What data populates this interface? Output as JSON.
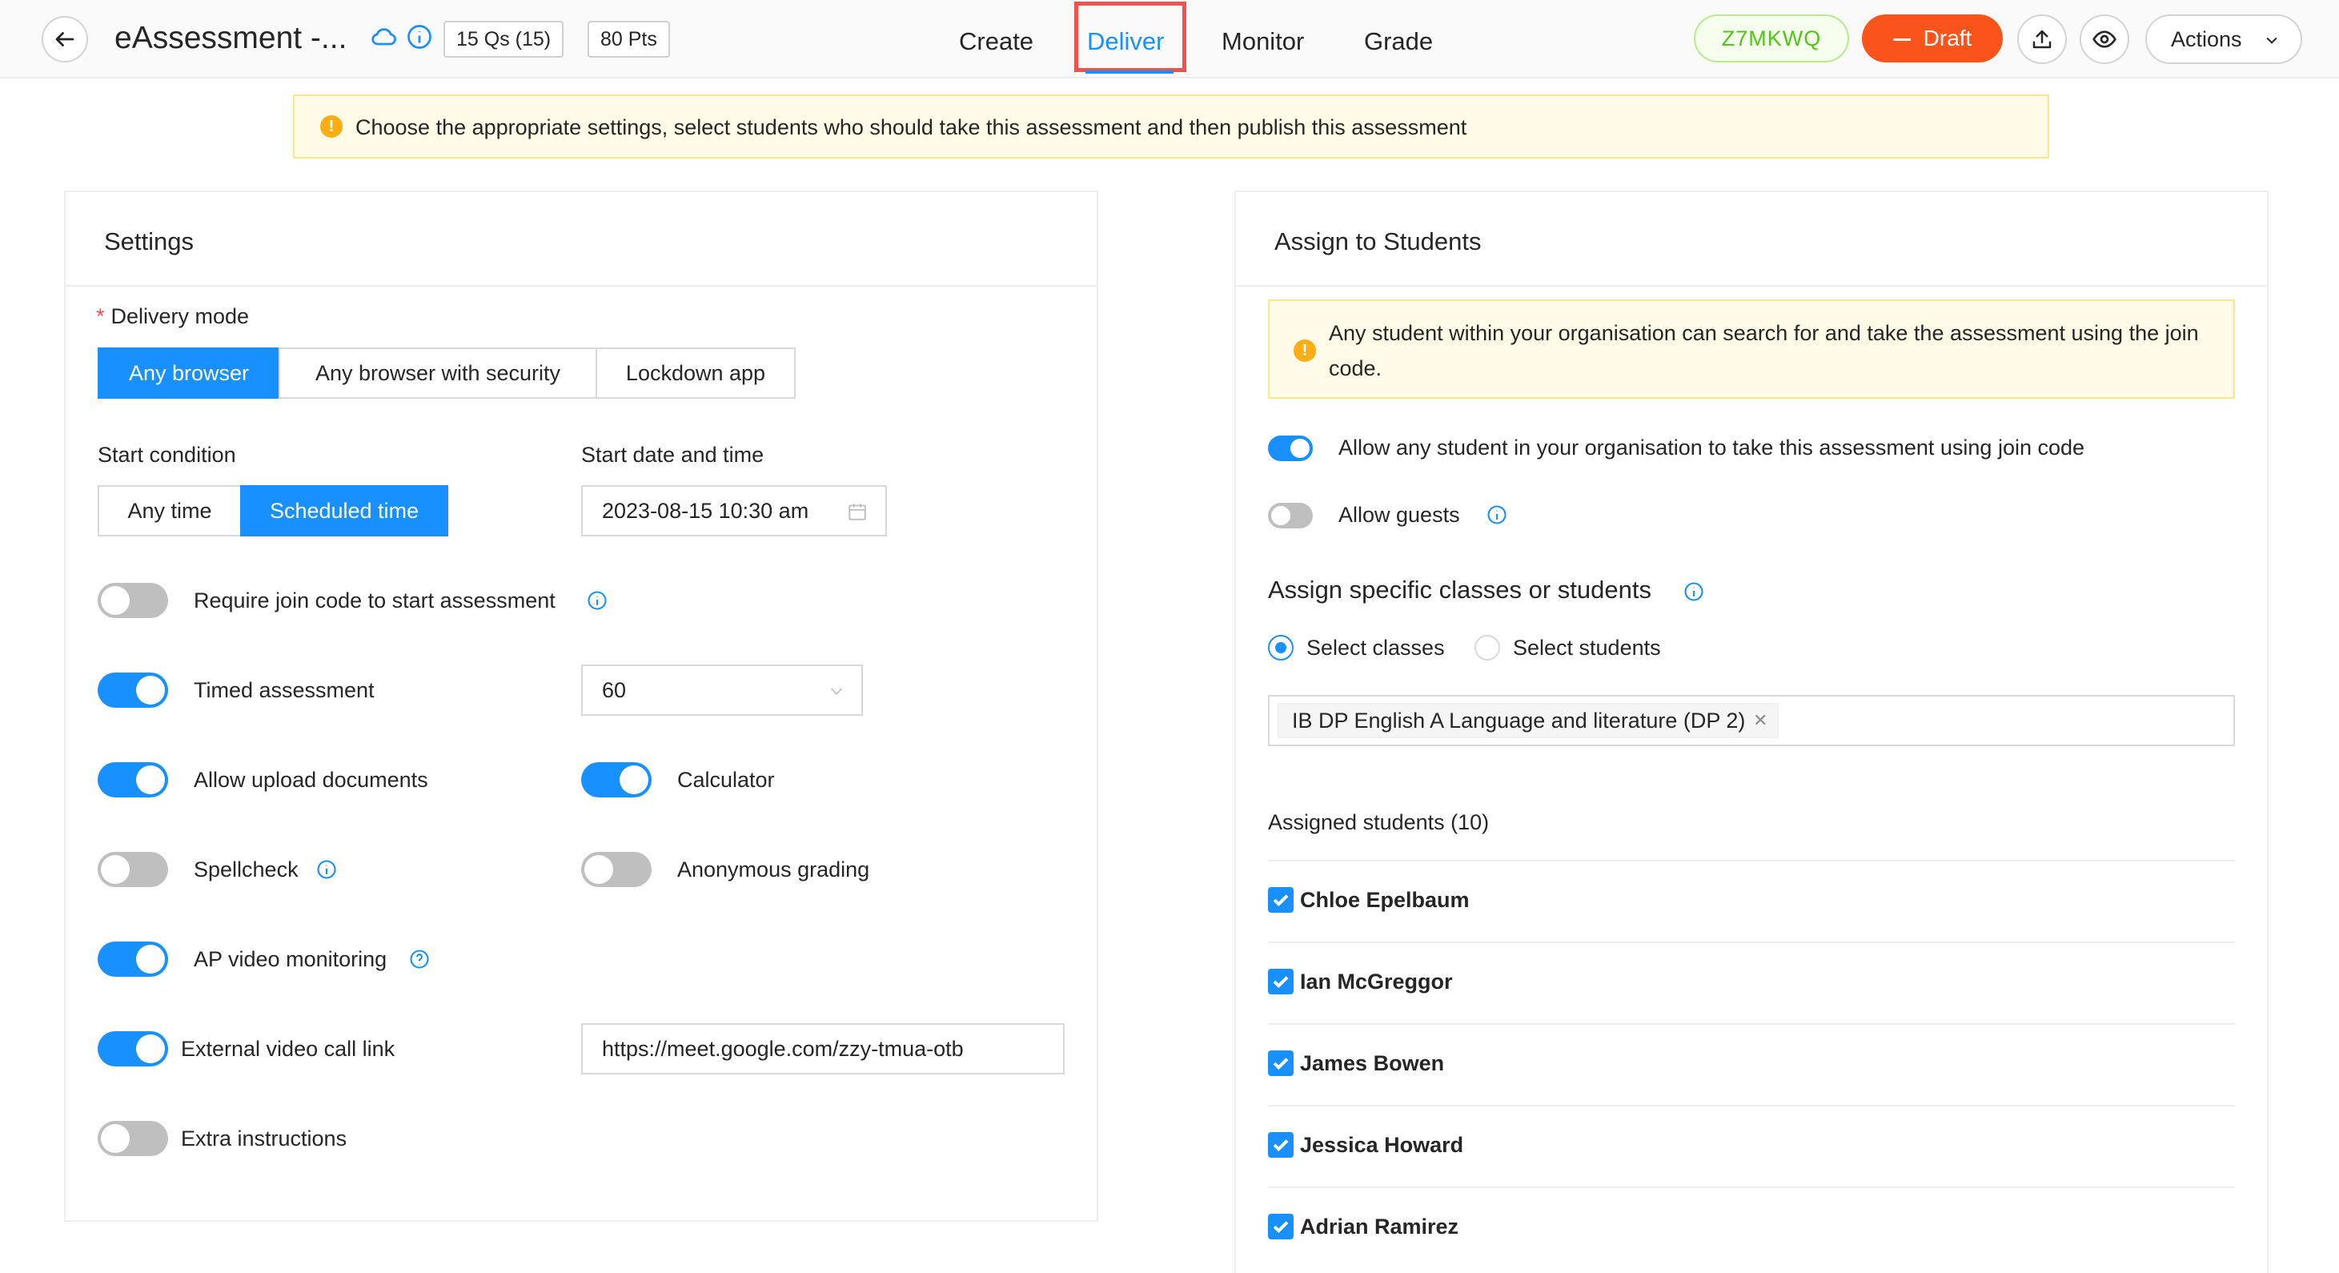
{
  "header": {
    "title": "eAssessment -...",
    "questions_badge": "15 Qs (15)",
    "points_badge": "80 Pts",
    "tabs": [
      {
        "label": "Create"
      },
      {
        "label": "Deliver"
      },
      {
        "label": "Monitor"
      },
      {
        "label": "Grade"
      }
    ],
    "join_code": "Z7MKWQ",
    "draft_label": "Draft",
    "actions_label": "Actions",
    "accent_color": "#1890ff",
    "draft_color": "#fa541c"
  },
  "banner": {
    "text": "Choose the appropriate settings, select students who should take this assessment and then publish this assessment"
  },
  "settings": {
    "title": "Settings",
    "delivery_mode_label": "Delivery mode",
    "delivery_modes": [
      "Any browser",
      "Any browser with security",
      "Lockdown app"
    ],
    "delivery_mode_selected": "Any browser",
    "start_condition_label": "Start condition",
    "start_conditions": [
      "Any time",
      "Scheduled time"
    ],
    "start_condition_selected": "Scheduled time",
    "start_datetime_label": "Start date and time",
    "start_datetime_value": "2023-08-15 10:30 am",
    "require_join_code": {
      "label": "Require join code to start assessment",
      "on": false
    },
    "timed_assessment": {
      "label": "Timed assessment",
      "on": true,
      "minutes": "60"
    },
    "allow_upload": {
      "label": "Allow upload documents",
      "on": true
    },
    "calculator": {
      "label": "Calculator",
      "on": true
    },
    "spellcheck": {
      "label": "Spellcheck",
      "on": false
    },
    "anonymous_grading": {
      "label": "Anonymous grading",
      "on": false
    },
    "ap_video": {
      "label": "AP video monitoring",
      "on": true
    },
    "external_video": {
      "label": "External video call link",
      "on": true,
      "url": "https://meet.google.com/zzy-tmua-otb"
    },
    "extra_instructions": {
      "label": "Extra instructions",
      "on": false
    }
  },
  "assign": {
    "title": "Assign to Students",
    "note": "Any student within your organisation can search for and take the assessment using the join code.",
    "allow_join_code": {
      "label": "Allow any student in your organisation to take this assessment using join code",
      "on": true
    },
    "allow_guests": {
      "label": "Allow guests",
      "on": false
    },
    "specific_label": "Assign specific classes or students",
    "radio_options": [
      "Select classes",
      "Select students"
    ],
    "radio_selected": "Select classes",
    "selected_class": "IB DP English A Language and literature (DP 2)",
    "assigned_label": "Assigned students (10)",
    "students": [
      {
        "name": "Chloe Epelbaum",
        "checked": true
      },
      {
        "name": "Ian McGreggor",
        "checked": true
      },
      {
        "name": "James Bowen",
        "checked": true
      },
      {
        "name": "Jessica Howard",
        "checked": true
      },
      {
        "name": "Adrian Ramirez",
        "checked": true
      }
    ]
  }
}
